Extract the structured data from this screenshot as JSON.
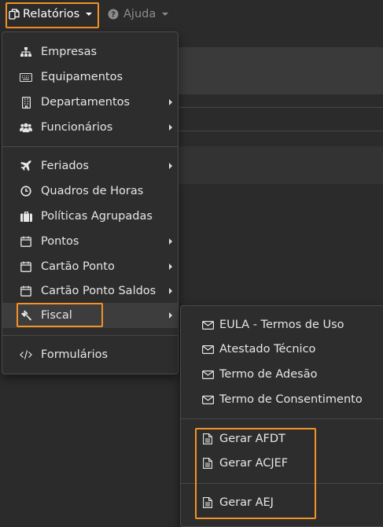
{
  "topbar": {
    "reports_label": "Relatórios",
    "help_label": "Ajuda"
  },
  "menu": {
    "items": [
      {
        "label": "Empresas"
      },
      {
        "label": "Equipamentos"
      },
      {
        "label": "Departamentos"
      },
      {
        "label": "Funcionários"
      },
      {
        "label": "Feriados"
      },
      {
        "label": "Quadros de Horas"
      },
      {
        "label": "Políticas Agrupadas"
      },
      {
        "label": "Pontos"
      },
      {
        "label": "Cartão Ponto"
      },
      {
        "label": "Cartão Ponto Saldos"
      },
      {
        "label": "Fiscal"
      },
      {
        "label": "Formulários"
      }
    ]
  },
  "submenu": {
    "items": [
      {
        "label": "EULA - Termos de Uso"
      },
      {
        "label": "Atestado Técnico"
      },
      {
        "label": "Termo de Adesão"
      },
      {
        "label": "Termo de Consentimento"
      },
      {
        "label": "Gerar AFDT"
      },
      {
        "label": "Gerar ACJEF"
      },
      {
        "label": "Gerar AEJ"
      }
    ]
  },
  "colors": {
    "highlight": "#f39226",
    "menu_bg": "#2d2d2d",
    "page_bg": "#2b2b2b"
  }
}
